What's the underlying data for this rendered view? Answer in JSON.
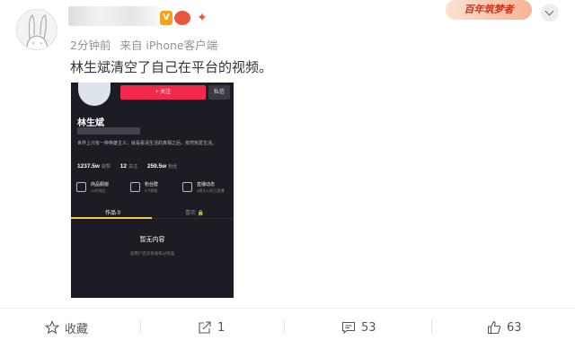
{
  "post": {
    "timestamp": "2分钟前",
    "source": "来自 iPhone客户端",
    "text": "林生斌清空了自己在平台的视频。"
  },
  "badges": {
    "verified": "V"
  },
  "promo": {
    "label": "百年筑梦者"
  },
  "embedded": {
    "follow_label": "+ 关注",
    "message_label": "私信",
    "profile_name": "林生斌",
    "bio": "世界上只有一种英雄主义，就是看清生活的真相之后，依然热爱生活。",
    "stats": [
      {
        "value": "1237.5w",
        "label": "获赞"
      },
      {
        "value": "12",
        "label": "关注"
      },
      {
        "value": "259.5w",
        "label": "粉丝"
      }
    ],
    "cards": [
      {
        "title": "商品橱窗",
        "sub": "26件商品"
      },
      {
        "title": "粉丝群",
        "sub": "5个群聊"
      },
      {
        "title": "直播动态",
        "sub": "6周天10月已直播"
      }
    ],
    "tab_active": "作品 0",
    "tab_inactive": "喜欢 🔒",
    "empty_title": "暂无内容",
    "empty_sub": "该用户还没有发布过作品"
  },
  "actions": {
    "collect": "收藏",
    "share": "1",
    "comment": "53",
    "like": "63"
  },
  "colors": {
    "accent": "#f2294e",
    "meta": "#939393"
  }
}
